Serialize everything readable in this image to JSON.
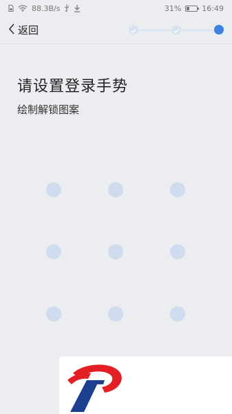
{
  "status_bar": {
    "network_speed": "88.3B/s",
    "battery": "31%",
    "battery_level": 0.31,
    "time": "16:49",
    "icons": [
      "sim-icon",
      "wifi-icon",
      "usb-icon",
      "download-icon",
      "battery-icon"
    ]
  },
  "nav": {
    "back_label": "返回",
    "steps": [
      {
        "state": "done"
      },
      {
        "state": "done"
      },
      {
        "state": "active"
      }
    ]
  },
  "content": {
    "title": "请设置登录手势",
    "subtitle": "绘制解锁图案",
    "pattern_dots": 9
  },
  "colors": {
    "background": "#ecedf0",
    "accent": "#3f7fe0",
    "dot": "#cfdcee",
    "logo_red": "#e31e25",
    "logo_blue": "#1d3f8f"
  }
}
